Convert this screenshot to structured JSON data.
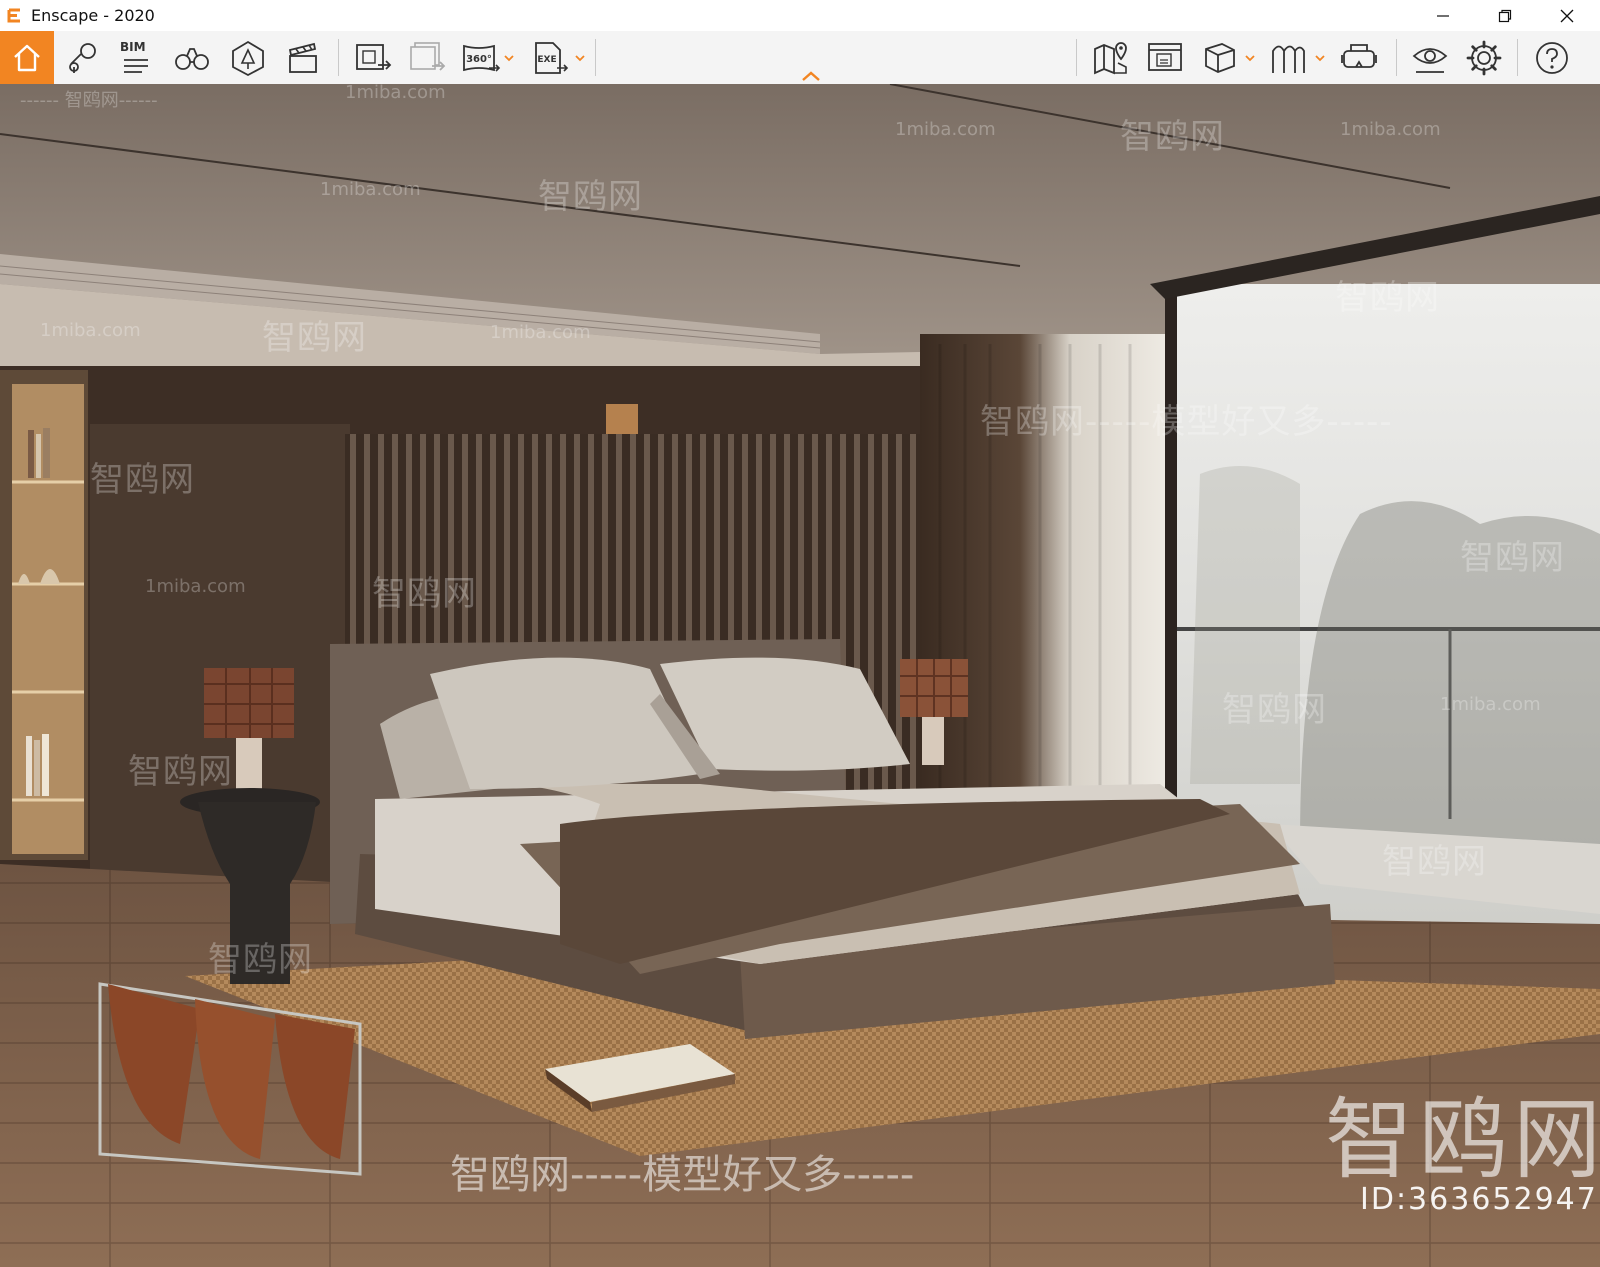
{
  "window": {
    "title": "Enscape - 2020",
    "controls": {
      "minimize": "minimize",
      "restore": "restore",
      "close": "close"
    }
  },
  "toolbar": {
    "bim_label": "BIM",
    "accent": "#f28522",
    "left_tools": [
      "home-icon",
      "views-icon",
      "bim-icon",
      "binoculars-icon",
      "asset-library-icon",
      "video-editor-icon",
      "screenshot-export-icon",
      "batch-render-icon",
      "panorama-360-icon",
      "exe-export-icon"
    ],
    "panorama_label": "360°",
    "exe_label": "EXE",
    "right_tools": [
      "map-icon",
      "web-standalone-icon",
      "cube-icon",
      "split-view-icon",
      "vr-headset-icon",
      "visual-settings-icon",
      "settings-icon",
      "help-icon"
    ]
  },
  "watermarks": {
    "site": "1miba.com",
    "cn_brand": "智鸥网",
    "slogan": "智鸥网-----模型好又多-----",
    "dash_brand": "------ 智鸥网------",
    "big_brand": "智鸥网",
    "id_text": "ID:363652947"
  }
}
